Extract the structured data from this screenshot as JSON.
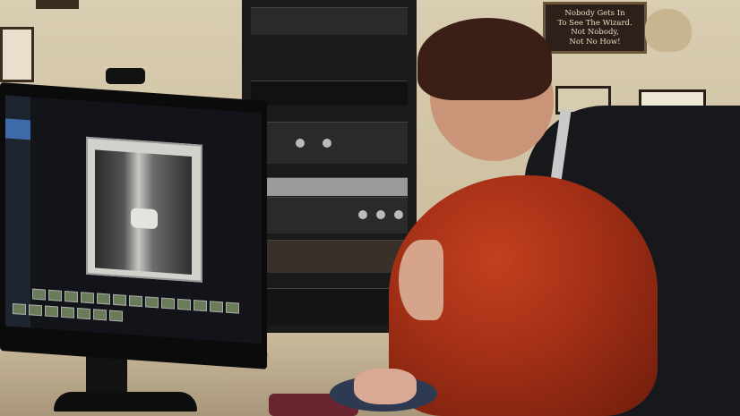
{
  "scene": {
    "sign_lines": [
      "Nobody Gets In",
      "To See The Wizard.",
      "Not Nobody,",
      "Not No How!"
    ],
    "colors": {
      "wall": "#d9cdb2",
      "hair_red": "#b23a1c",
      "rack": "#1b1a1a",
      "desk": "#cbbb9d"
    }
  }
}
